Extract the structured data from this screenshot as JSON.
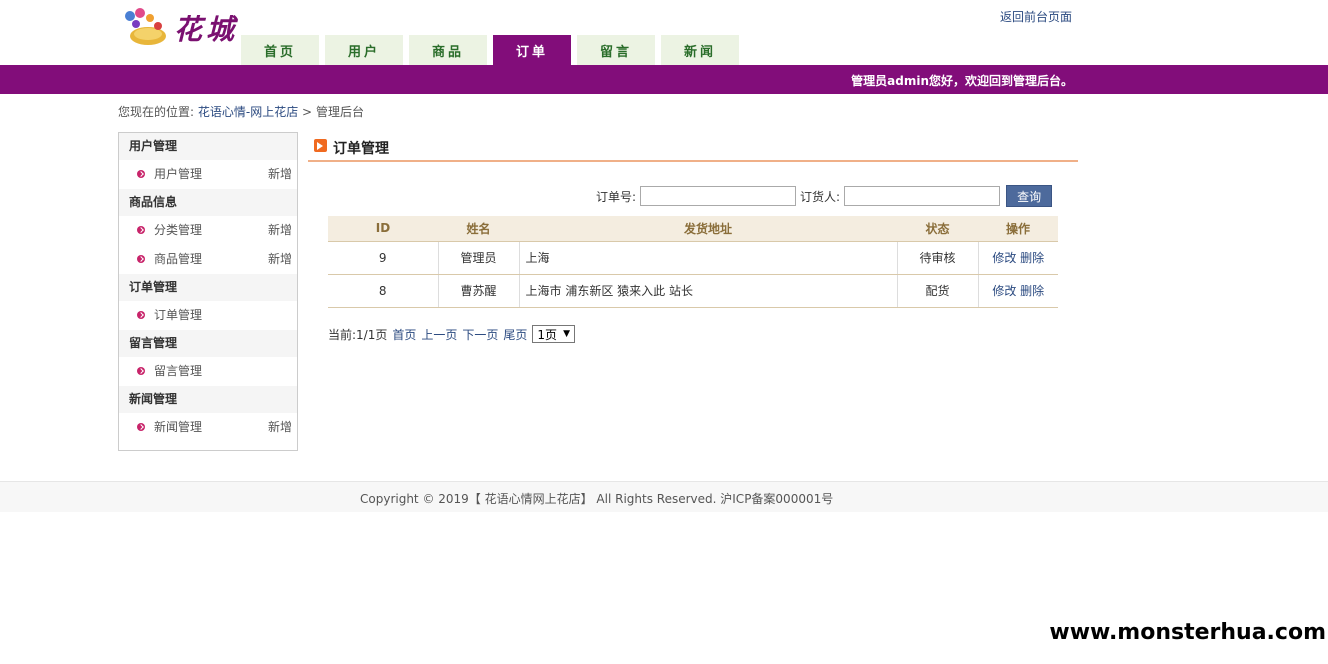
{
  "header": {
    "logo_text": "花城",
    "back_link": "返回前台页面",
    "nav": [
      "首页",
      "用户",
      "商品",
      "订单",
      "留言",
      "新闻"
    ],
    "active_tab": "订单",
    "welcome": "管理员admin您好，欢迎回到管理后台。"
  },
  "breadcrumb": {
    "prefix": "您现在的位置:",
    "home": "花语心情-网上花店",
    "separator": ">",
    "current": "管理后台"
  },
  "sidebar": {
    "groups": [
      {
        "title": "用户管理",
        "items": [
          {
            "label": "用户管理",
            "add": "新增"
          }
        ]
      },
      {
        "title": "商品信息",
        "items": [
          {
            "label": "分类管理",
            "add": "新增"
          },
          {
            "label": "商品管理",
            "add": "新增"
          }
        ]
      },
      {
        "title": "订单管理",
        "items": [
          {
            "label": "订单管理",
            "add": ""
          }
        ]
      },
      {
        "title": "留言管理",
        "items": [
          {
            "label": "留言管理",
            "add": ""
          }
        ]
      },
      {
        "title": "新闻管理",
        "items": [
          {
            "label": "新闻管理",
            "add": "新增"
          }
        ]
      }
    ]
  },
  "main": {
    "title": "订单管理",
    "search": {
      "order_no_label": "订单号:",
      "order_no_value": "",
      "buyer_label": "订货人:",
      "buyer_value": "",
      "query_button": "查询"
    },
    "table": {
      "headers": [
        "ID",
        "姓名",
        "发货地址",
        "状态",
        "操作"
      ],
      "rows": [
        {
          "id": "9",
          "name": "管理员",
          "address": "上海",
          "status": "待审核",
          "edit": "修改",
          "delete": "删除"
        },
        {
          "id": "8",
          "name": "曹苏醒",
          "address": "上海市 浦东新区 猿来入此 站长",
          "status": "配货",
          "edit": "修改",
          "delete": "删除"
        }
      ]
    },
    "pager": {
      "info": "当前:1/1页",
      "first": "首页",
      "prev": "上一页",
      "next": "下一页",
      "last": "尾页",
      "select_value": "1页"
    }
  },
  "footer": {
    "copyright": "Copyright © 2019【 花语心情网上花店】 All Rights Reserved. 沪ICP备案000001号"
  },
  "watermark": "www.monsterhua.com",
  "colors": {
    "brand_purple": "#820d7a",
    "nav_tab_bg": "#ecf3e3",
    "link_blue": "#2b4a80",
    "table_header_bg": "#f4ede0",
    "title_underline": "#f0b088",
    "button_blue": "#4d6a9c"
  }
}
